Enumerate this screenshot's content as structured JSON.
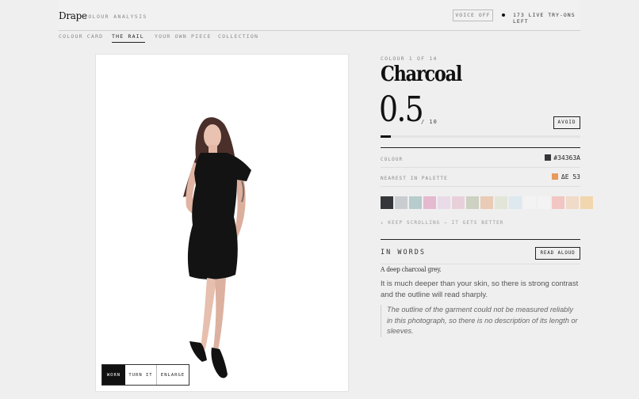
{
  "header": {
    "brand": "Drape",
    "subtitle": "COLOUR ANALYSIS",
    "voice_button": "VOICE OFF",
    "live_count": "173 LIVE TRY-ONS LEFT"
  },
  "tabs": [
    {
      "label": "COLOUR CARD",
      "active": false
    },
    {
      "label": "THE RAIL",
      "active": true
    },
    {
      "label": "YOUR OWN PIECE",
      "active": false
    },
    {
      "label": "COLLECTION",
      "active": false
    }
  ],
  "photo": {
    "controls": [
      "WORN",
      "TURN IT",
      "ENLARGE"
    ],
    "active_control": "WORN"
  },
  "colour": {
    "index_label": "COLOUR 1 OF 14",
    "name": "Charcoal",
    "score": "0.5",
    "score_max": "/ 10",
    "score_fraction": 0.05,
    "verdict_button": "AVOID",
    "rows": [
      {
        "label": "COLOUR",
        "value": "#34363A",
        "swatch": "#34363a"
      },
      {
        "label": "NEAREST IN PALETTE",
        "value": "ΔE 53",
        "swatch": "#e79a5a"
      }
    ],
    "palette": [
      "#34363a",
      "#c9cdd0",
      "#b7cccc",
      "#e5b9cf",
      "#e9dbe8",
      "#e8d0da",
      "#ccd1c1",
      "#e9cbb6",
      "#e1e6d9",
      "#dde8ef",
      "#f3f3f3",
      "#f3f3f3",
      "#f2c6c2",
      "#f0dac8",
      "#f2d6ae"
    ],
    "hint": "↓ KEEP SCROLLING — IT GETS BETTER"
  },
  "words": {
    "heading": "IN WORDS",
    "read_aloud": "READ ALOUD",
    "serif_line": "A deep charcoal grey.",
    "paragraph": "It is much deeper than your skin, so there is strong contrast and the outline will read sharply.",
    "note": "The outline of the garment could not be measured reliably in this photograph, so there is no description of its length or sleeves."
  },
  "colors": {
    "background": "#efefef",
    "ink": "#111111",
    "muted": "#888888"
  }
}
